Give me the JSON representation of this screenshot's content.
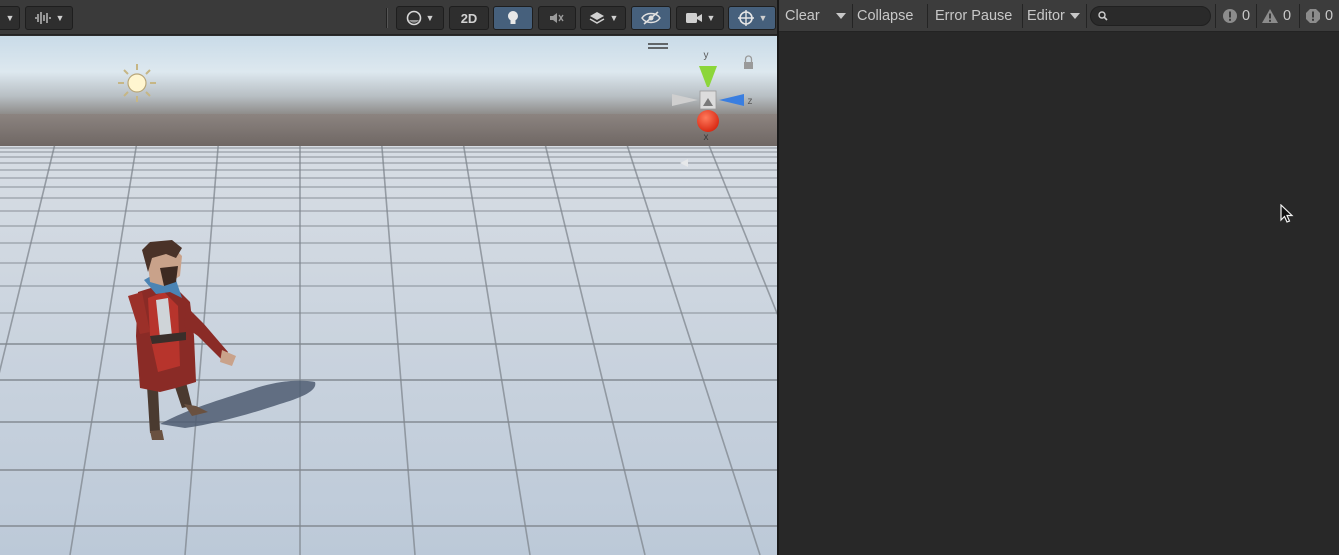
{
  "scene_toolbar": {
    "btn_2d_label": "2D",
    "active_color": "#46607c"
  },
  "console": {
    "clear_label": "Clear",
    "collapse_label": "Collapse",
    "error_pause_label": "Error Pause",
    "editor_label": "Editor",
    "search": {
      "value": "",
      "placeholder": ""
    },
    "counts": {
      "info": "0",
      "warning": "0",
      "error": "0"
    }
  },
  "gizmo": {
    "y_label": "y",
    "z_label": "z",
    "x_label": "x",
    "x_color": "#e8402c",
    "y_color": "#8cd63a",
    "z_color": "#3a7ee0"
  },
  "icons": [
    "dropdown-arrow-icon",
    "audio-waveform-icon",
    "shading-sphere-icon",
    "lightbulb-icon",
    "audio-mute-icon",
    "layers-icon",
    "visibility-off-icon",
    "camera-icon",
    "gizmos-icon",
    "search-icon",
    "info-icon",
    "warning-icon",
    "error-icon",
    "sun-icon",
    "lock-icon",
    "menu-icon",
    "mouse-cursor-icon"
  ]
}
